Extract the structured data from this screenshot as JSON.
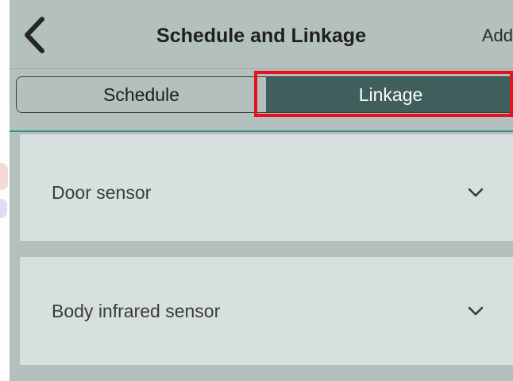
{
  "header": {
    "title": "Schedule and Linkage",
    "add_label": "Add",
    "back_icon": "chevron-left-icon"
  },
  "tabs": [
    {
      "label": "Schedule",
      "selected": false
    },
    {
      "label": "Linkage",
      "selected": true
    }
  ],
  "linkage_items": [
    {
      "label": "Door sensor",
      "icon": "chevron-down-icon"
    },
    {
      "label": "Body infrared sensor",
      "icon": "chevron-down-icon"
    }
  ],
  "colors": {
    "header_bg": "#b3c0bd",
    "selected_tab": "#405e5b",
    "item_bg": "#d6e0de",
    "highlight": "#e8121c"
  }
}
